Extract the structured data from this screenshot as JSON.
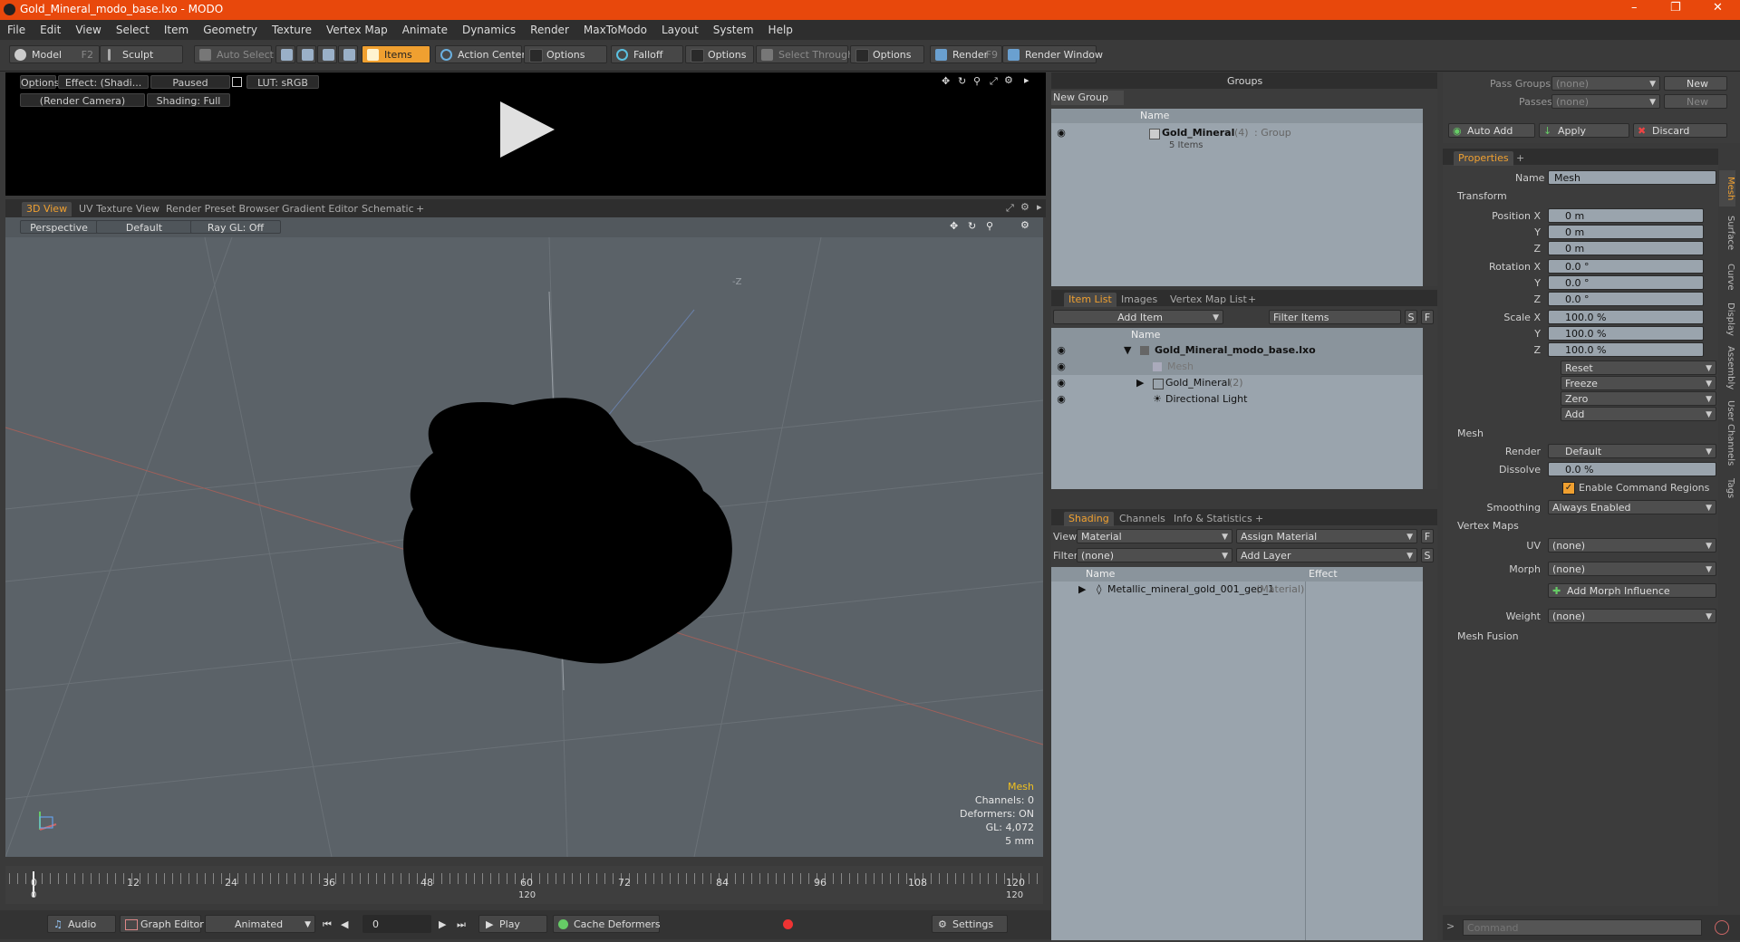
{
  "window": {
    "title": "Gold_Mineral_modo_base.lxo - MODO"
  },
  "menu": [
    "File",
    "Edit",
    "View",
    "Select",
    "Item",
    "Geometry",
    "Texture",
    "Vertex Map",
    "Animate",
    "Dynamics",
    "Render",
    "MaxToModo",
    "Layout",
    "System",
    "Help"
  ],
  "toolbar": {
    "model": "Model",
    "model_key": "F2",
    "sculpt": "Sculpt",
    "auto_select": "Auto Select",
    "items": "Items",
    "action_center": "Action Center",
    "options1": "Options",
    "falloff": "Falloff",
    "options2": "Options",
    "select_through": "Select Through",
    "options3": "Options",
    "render": "Render",
    "render_key": "F9",
    "render_window": "Render Window"
  },
  "preview": {
    "options": "Options",
    "effect": "Effect: (Shadi...",
    "paused": "Paused",
    "lut": "LUT: sRGB",
    "camera": "(Render Camera)",
    "shading": "Shading: Full"
  },
  "viewtabs": [
    "3D View",
    "UV Texture View",
    "Render Preset Browser",
    "Gradient Editor",
    "Schematic",
    "+"
  ],
  "viewport": {
    "perspective": "Perspective",
    "default": "Default",
    "raygl": "Ray GL: Off",
    "axis_z": "-Z",
    "info": {
      "title": "Mesh",
      "channels": "Channels: 0",
      "deformers": "Deformers: ON",
      "gl": "GL: 4,072",
      "size": "5 mm"
    }
  },
  "timeline": {
    "ticks": [
      "0",
      "12",
      "24",
      "36",
      "48",
      "60",
      "72",
      "84",
      "96",
      "108",
      "120"
    ],
    "sub_left": "0",
    "sub_mid": "120",
    "sub_right": "120"
  },
  "bottombar": {
    "audio": "Audio",
    "graph_editor": "Graph Editor",
    "animated": "Animated",
    "frame": "0",
    "play": "Play",
    "cache": "Cache Deformers",
    "settings": "Settings"
  },
  "groups": {
    "title": "Groups",
    "new_group": "New Group",
    "col_name": "Name",
    "row_name": "Gold_Mineral",
    "row_count": "(4)",
    "row_type": ": Group",
    "row_sub": "5 Items"
  },
  "itemlist": {
    "tabs": [
      "Item List",
      "Images",
      "Vertex Map List",
      "+"
    ],
    "add_item": "Add Item",
    "filter": "Filter Items",
    "s": "S",
    "f": "F",
    "col_name": "Name",
    "rows": [
      {
        "name": "Gold_Mineral_modo_base.lxo",
        "extra": ""
      },
      {
        "name": "Mesh",
        "extra": ""
      },
      {
        "name": "Gold_Mineral",
        "extra": "(2)"
      },
      {
        "name": "Directional Light",
        "extra": ""
      }
    ]
  },
  "shading": {
    "tabs": [
      "Shading",
      "Channels",
      "Info & Statistics",
      "+"
    ],
    "view_label": "View",
    "view_value": "Material",
    "assign": "Assign Material",
    "f": "F",
    "filter_label": "Filter",
    "filter_value": "(none)",
    "add_layer": "Add Layer",
    "s": "S",
    "col_name": "Name",
    "col_effect": "Effect",
    "row_name": "Metallic_mineral_gold_001_geo_1",
    "row_type": "(Material)"
  },
  "passes": {
    "pass_groups": "Pass Groups",
    "pass_value": "(none)",
    "new": "New",
    "passes": "Passes",
    "passes_value": "(none)",
    "new2": "New"
  },
  "actions": {
    "auto_add": "Auto Add",
    "apply": "Apply",
    "discard": "Discard"
  },
  "properties": {
    "tab": "Properties",
    "plus": "+",
    "name_label": "Name",
    "name_value": "Mesh",
    "transform": "Transform",
    "pos_x_label": "Position X",
    "pos_x": "0 m",
    "y": "Y",
    "pos_y": "0 m",
    "z": "Z",
    "pos_z": "0 m",
    "rot_x_label": "Rotation X",
    "rot_x": "0.0 °",
    "rot_y": "0.0 °",
    "rot_z": "0.0 °",
    "scale_x_label": "Scale X",
    "scale_x": "100.0 %",
    "scale_y": "100.0 %",
    "scale_z": "100.0 %",
    "reset": "Reset",
    "freeze": "Freeze",
    "zero": "Zero",
    "add": "Add",
    "mesh": "Mesh",
    "render_label": "Render",
    "render_value": "Default",
    "dissolve_label": "Dissolve",
    "dissolve_value": "0.0 %",
    "enable_cmd": "Enable Command Regions",
    "smoothing_label": "Smoothing",
    "smoothing_value": "Always Enabled",
    "vertex_maps": "Vertex Maps",
    "uv_label": "UV",
    "uv_value": "(none)",
    "morph_label": "Morph",
    "morph_value": "(none)",
    "add_morph": "Add Morph Influence",
    "weight_label": "Weight",
    "weight_value": "(none)",
    "mesh_fusion": "Mesh Fusion"
  },
  "side_tabs": [
    "Mesh",
    "Surface",
    "Curve",
    "Display",
    "Assembly",
    "User Channels",
    "Tags"
  ],
  "command": {
    "placeholder": "Command"
  },
  "colors": {
    "accent": "#f0a030",
    "titlebar": "#e8480c",
    "viewport": "#5b6268",
    "list": "#9aa4ad"
  }
}
